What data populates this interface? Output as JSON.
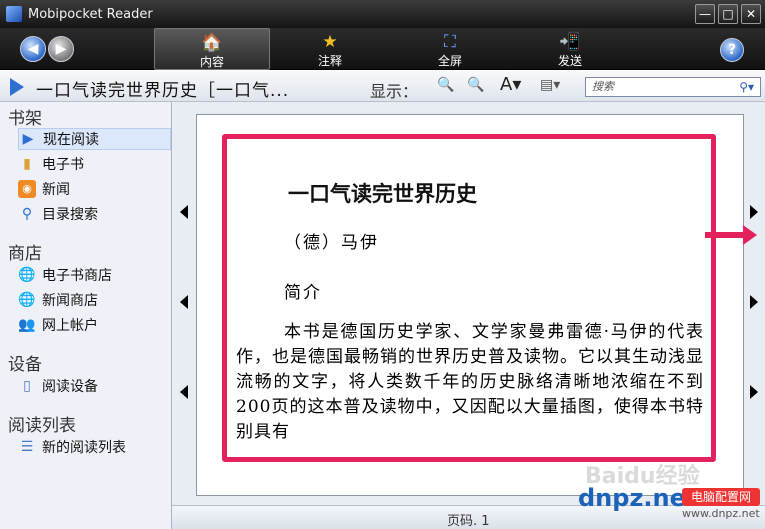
{
  "window": {
    "title": "Mobipocket Reader",
    "min": "—",
    "max": "□",
    "close": "✕"
  },
  "toolbar": {
    "content_label": "内容",
    "annotate_label": "注释",
    "fullscreen_label": "全屏",
    "send_label": "发送",
    "help": "?"
  },
  "infobar": {
    "book_title": "一口气读完世界历史［一口气...",
    "display_label": "显示：",
    "search_placeholder": "搜索"
  },
  "sidebar": {
    "bookshelf": "书架",
    "now_reading": "现在阅读",
    "ebooks": "电子书",
    "news": "新闻",
    "catalog_search": "目录搜索",
    "store": "商店",
    "ebook_store": "电子书商店",
    "news_store": "新闻商店",
    "online_account": "网上帐户",
    "devices": "设备",
    "reading_device": "阅读设备",
    "reading_list": "阅读列表",
    "new_reading_list": "新的阅读列表"
  },
  "page": {
    "heading": "一口气读完世界历史",
    "author": "（德）马伊",
    "intro": "简介",
    "body": "本书是德国历史学家、文学家曼弗雷德·马伊的代表作，也是德国最畅销的世界历史普及读物。它以其生动浅显流畅的文字，将人类数千年的历史脉络清晰地浓缩在不到200页的这本普及读物中，又因配以大量插图，使得本书特别具有"
  },
  "status": {
    "page": "页码. 1"
  },
  "watermark": {
    "site": "dnpz.net",
    "badge": "电脑配置网",
    "sub": "www.dnpz.net",
    "baidu": "Baidu经验"
  }
}
